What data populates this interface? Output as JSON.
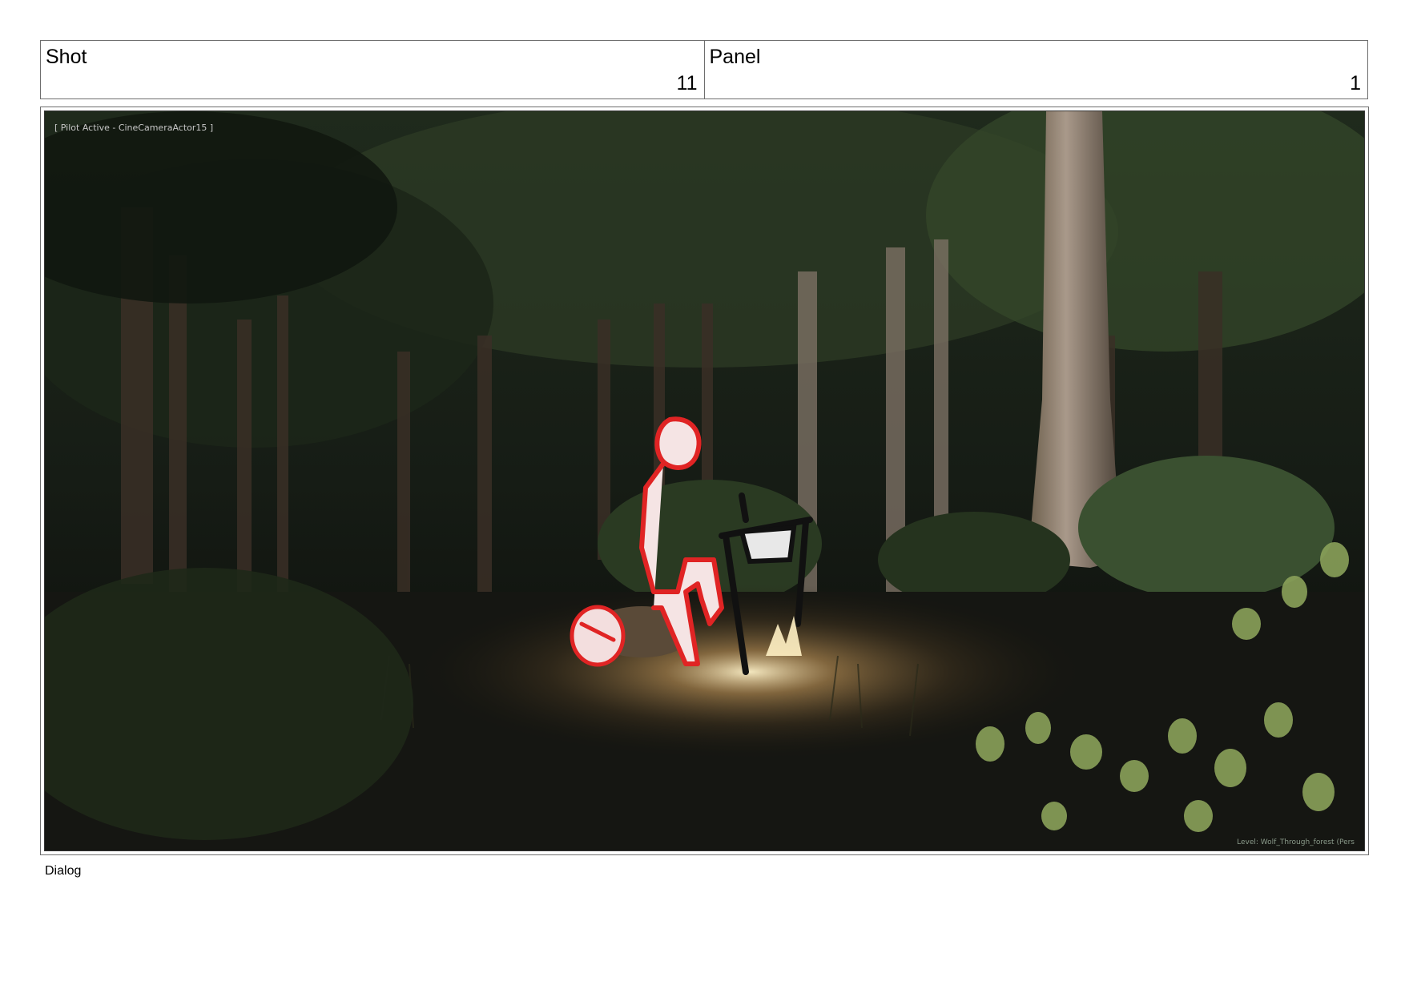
{
  "header": {
    "shot_label": "Shot",
    "shot_value": "11",
    "panel_label": "Panel",
    "panel_value": "1"
  },
  "viewport": {
    "pilot_text": "[ Pilot Active - CineCameraActor15 ]",
    "level_text": "Level:  Wolf_Through_forest (Pers",
    "sketch_color": "#e02424",
    "scene": "night forest with campfire"
  },
  "dialog": {
    "label": "Dialog"
  }
}
